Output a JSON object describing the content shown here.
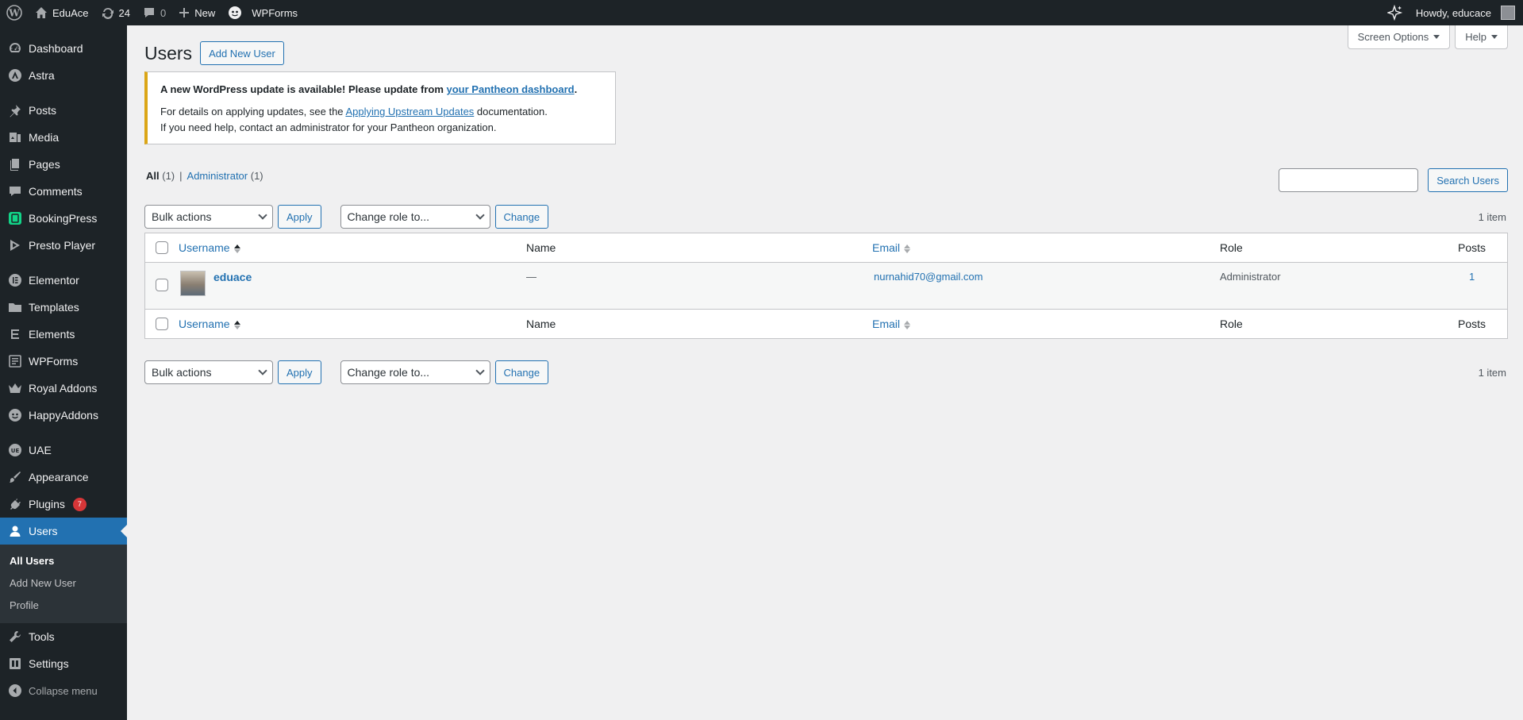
{
  "adminbar": {
    "site_name": "EduAce",
    "updates_count": "24",
    "comments_count": "0",
    "new_label": "New",
    "wpforms_label": "WPForms",
    "howdy": "Howdy, educace"
  },
  "sidebar": {
    "items": [
      {
        "label": "Dashboard"
      },
      {
        "label": "Astra"
      },
      {
        "label": "Posts"
      },
      {
        "label": "Media"
      },
      {
        "label": "Pages"
      },
      {
        "label": "Comments"
      },
      {
        "label": "BookingPress"
      },
      {
        "label": "Presto Player"
      },
      {
        "label": "Elementor"
      },
      {
        "label": "Templates"
      },
      {
        "label": "Elements"
      },
      {
        "label": "WPForms"
      },
      {
        "label": "Royal Addons"
      },
      {
        "label": "HappyAddons"
      },
      {
        "label": "UAE"
      },
      {
        "label": "Appearance"
      },
      {
        "label": "Plugins",
        "badge": "7"
      },
      {
        "label": "Users"
      },
      {
        "label": "Tools"
      },
      {
        "label": "Settings"
      }
    ],
    "submenu": [
      "All Users",
      "Add New User",
      "Profile"
    ],
    "collapse_label": "Collapse menu"
  },
  "screen_meta": {
    "screen_options": "Screen Options",
    "help": "Help"
  },
  "page": {
    "title": "Users",
    "add_new": "Add New User"
  },
  "notice": {
    "line1_prefix": "A new WordPress update is available! Please update from ",
    "line1_link": "your Pantheon dashboard",
    "line1_suffix": ".",
    "line2_prefix": "For details on applying updates, see the ",
    "line2_link": "Applying Upstream Updates",
    "line2_suffix": " documentation.",
    "line3": "If you need help, contact an administrator for your Pantheon organization."
  },
  "views": {
    "all": "All",
    "all_count": "(1)",
    "sep": "|",
    "admin": "Administrator",
    "admin_count": "(1)"
  },
  "search": {
    "button": "Search Users",
    "value": ""
  },
  "tablenav": {
    "bulk_actions": "Bulk actions",
    "apply": "Apply",
    "change_role": "Change role to...",
    "change": "Change",
    "items_count": "1 item"
  },
  "table": {
    "columns": {
      "username": "Username",
      "name": "Name",
      "email": "Email",
      "role": "Role",
      "posts": "Posts"
    },
    "rows": [
      {
        "username": "eduace",
        "name": "—",
        "email": "nurnahid70@gmail.com",
        "role": "Administrator",
        "posts": "1"
      }
    ]
  },
  "colors": {
    "accent": "#2271b1",
    "adminbar_bg": "#1d2327",
    "notice_border": "#dba617",
    "badge": "#d63638"
  }
}
